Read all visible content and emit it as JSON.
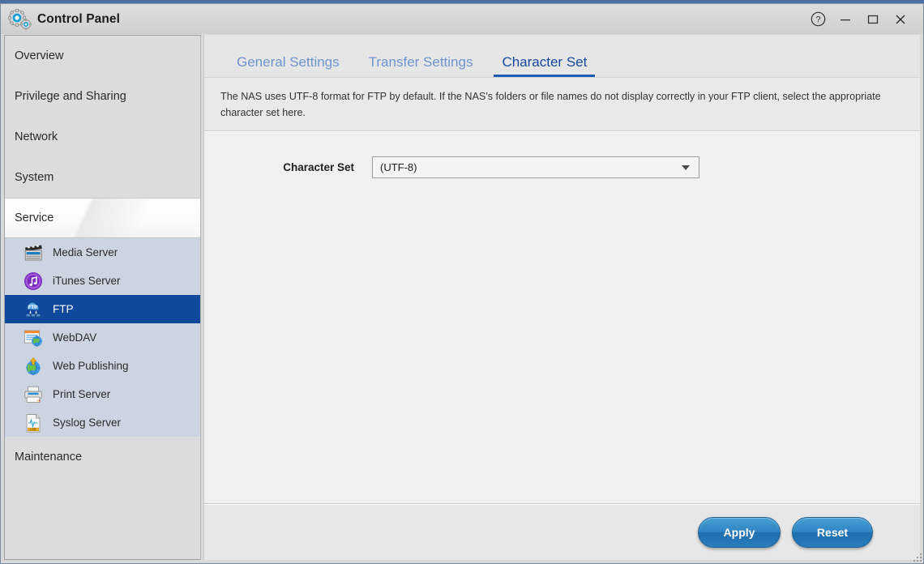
{
  "window": {
    "title": "Control Panel",
    "logo_icon": "gears-icon",
    "controls": [
      {
        "name": "help-button",
        "icon": "question-circle-icon",
        "label": "?"
      },
      {
        "name": "minimize-button",
        "icon": "minimize-icon",
        "label": "—"
      },
      {
        "name": "maximize-button",
        "icon": "maximize-icon",
        "label": "❐"
      },
      {
        "name": "close-button",
        "icon": "close-icon",
        "label": "✕"
      }
    ]
  },
  "sidebar": {
    "categories": [
      {
        "label": "Overview",
        "expanded": false
      },
      {
        "label": "Privilege and Sharing",
        "expanded": false
      },
      {
        "label": "Network",
        "expanded": false
      },
      {
        "label": "System",
        "expanded": false
      },
      {
        "label": "Service",
        "expanded": true
      },
      {
        "label": "Maintenance",
        "expanded": false
      }
    ],
    "service_items": [
      {
        "label": "Media Server",
        "icon": "clapperboard-icon",
        "selected": false
      },
      {
        "label": "iTunes Server",
        "icon": "music-note-icon",
        "selected": false
      },
      {
        "label": "FTP",
        "icon": "ftp-cloud-icon",
        "selected": true
      },
      {
        "label": "WebDAV",
        "icon": "window-globe-icon",
        "selected": false
      },
      {
        "label": "Web Publishing",
        "icon": "globe-upload-icon",
        "selected": false
      },
      {
        "label": "Print Server",
        "icon": "printer-icon",
        "selected": false
      },
      {
        "label": "Syslog Server",
        "icon": "log-document-icon",
        "selected": false
      }
    ]
  },
  "main": {
    "tabs": [
      {
        "label": "General Settings",
        "active": false
      },
      {
        "label": "Transfer Settings",
        "active": false
      },
      {
        "label": "Character Set",
        "active": true
      }
    ],
    "description": "The NAS uses UTF-8 format for FTP by default. If the NAS's folders or file names do not display correctly in your FTP client, select the appropriate character set here.",
    "form": {
      "character_set": {
        "label": "Character Set",
        "value": "(UTF-8)",
        "caret_icon": "chevron-down-icon"
      }
    }
  },
  "footer": {
    "apply_label": "Apply",
    "reset_label": "Reset"
  },
  "colors": {
    "accent_blue": "#10499c",
    "tab_active": "#15489e",
    "tab_inactive": "#6e94cf",
    "button_blue": "#2f84c3",
    "sidebar_bg": "#dcdcdc",
    "subitem_bg": "#ccd4e2"
  }
}
